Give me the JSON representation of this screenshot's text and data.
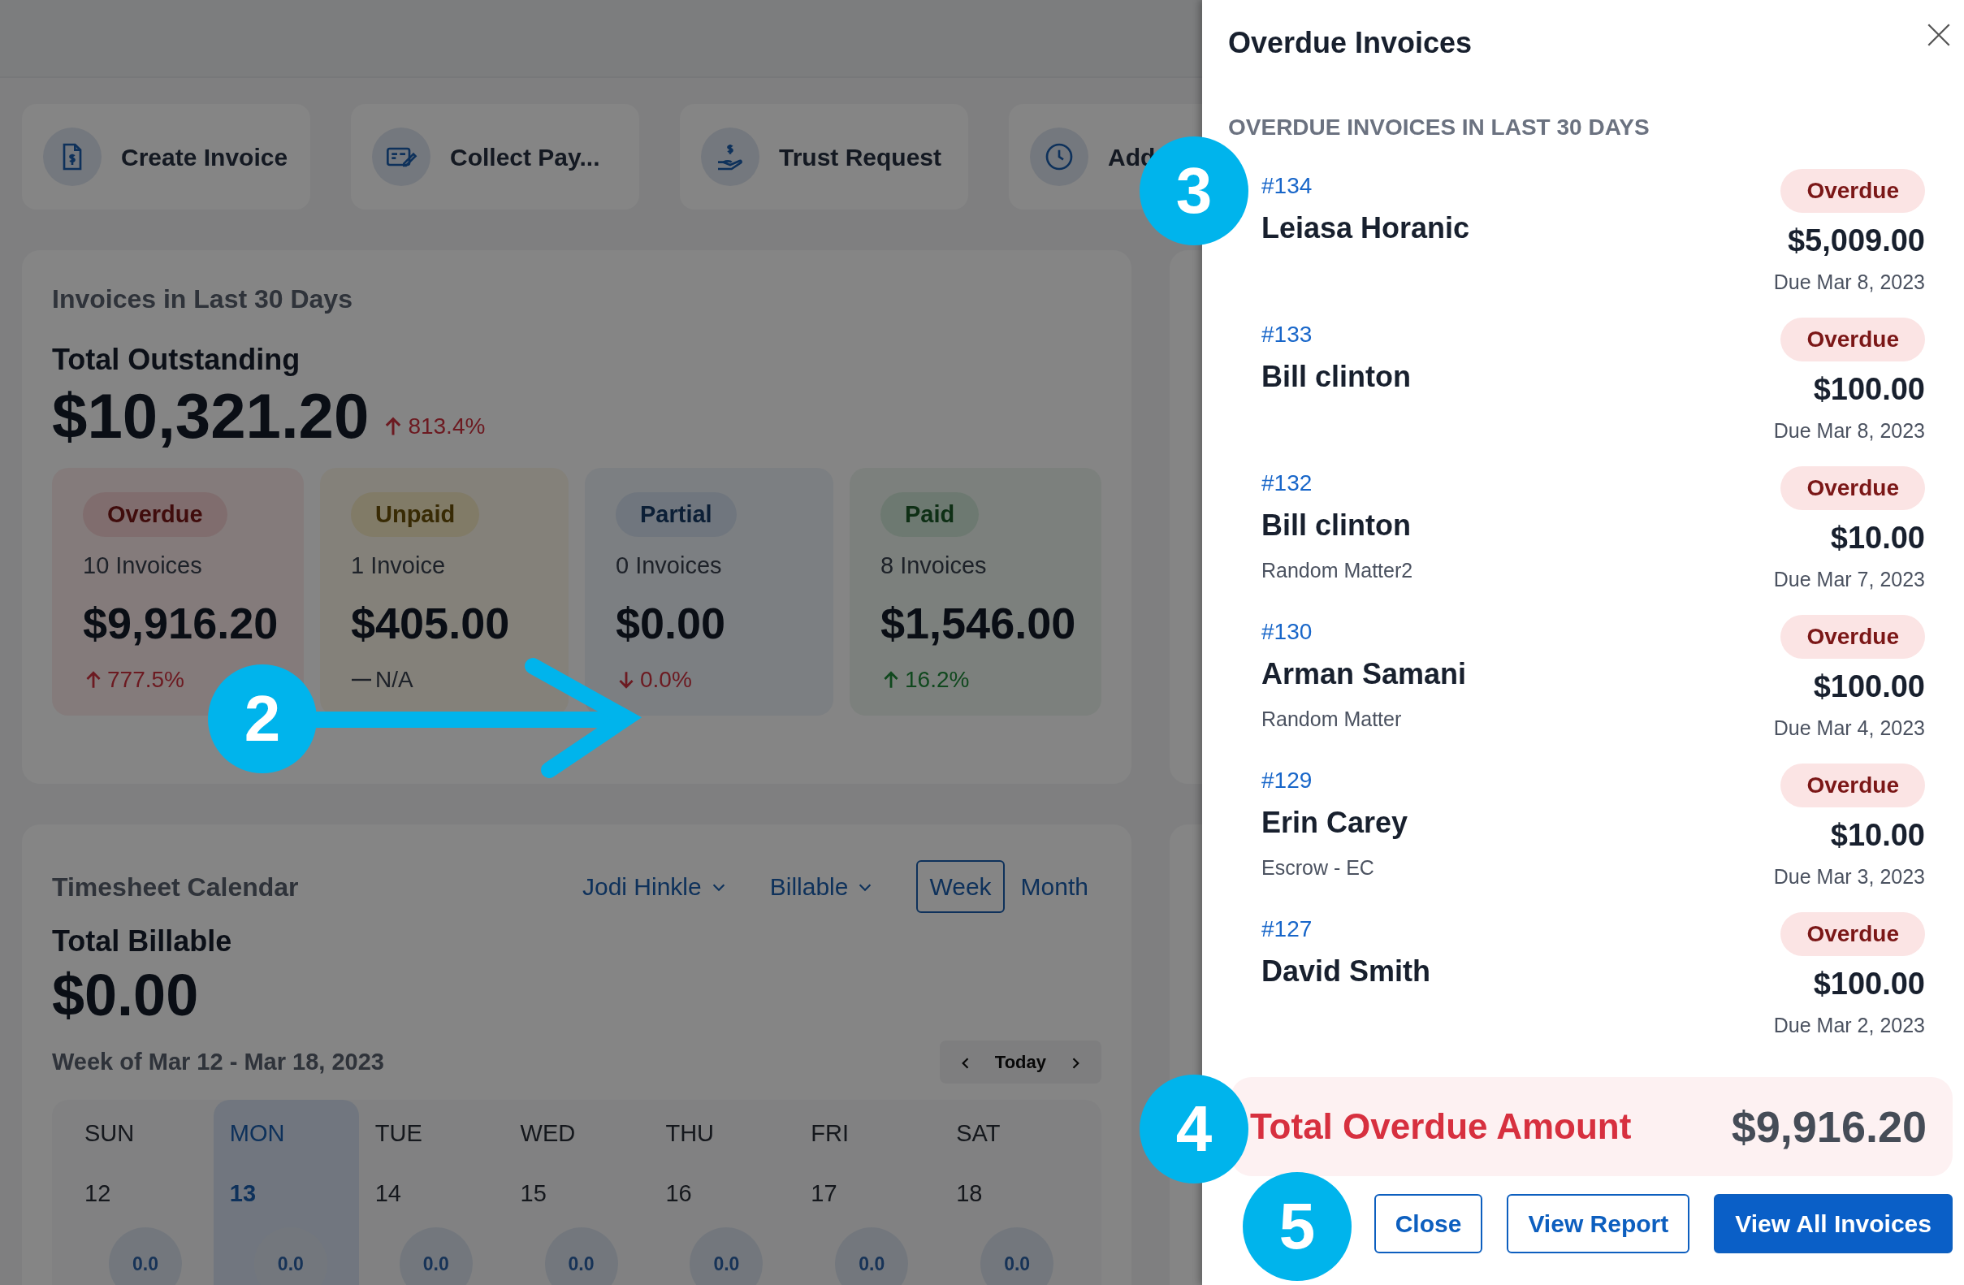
{
  "actions": [
    {
      "kind": "invoice",
      "label": "Create Invoice"
    },
    {
      "kind": "payment",
      "label": "Collect Pay..."
    },
    {
      "kind": "trust",
      "label": "Trust Request"
    },
    {
      "kind": "clock",
      "label": "Add"
    }
  ],
  "invoices_card": {
    "title": "Invoices in Last 30 Days",
    "total_label": "Total Outstanding",
    "total": "$10,321.20",
    "change": {
      "kind": "up",
      "favorable": false,
      "text": "813.4%"
    },
    "stats": [
      {
        "kind": "overdue",
        "badge": "Overdue",
        "count": "10 Invoices",
        "amount": "$9,916.20",
        "change": {
          "kind": "up",
          "favorable": false,
          "text": "777.5%"
        }
      },
      {
        "kind": "unpaid",
        "badge": "Unpaid",
        "count": "1 Invoice",
        "amount": "$405.00",
        "change": {
          "kind": "flat",
          "text": "N/A"
        }
      },
      {
        "kind": "partial",
        "badge": "Partial",
        "count": "0 Invoices",
        "amount": "$0.00",
        "change": {
          "kind": "down",
          "favorable": false,
          "text": "0.0%"
        }
      },
      {
        "kind": "paid",
        "badge": "Paid",
        "count": "8 Invoices",
        "amount": "$1,546.00",
        "change": {
          "kind": "up",
          "favorable": true,
          "text": "16.2%"
        }
      }
    ]
  },
  "timesheet": {
    "title": "Timesheet Calendar",
    "filters": [
      {
        "label": "Jodi Hinkle"
      },
      {
        "label": "Billable"
      }
    ],
    "views": [
      {
        "label": "Week",
        "selected": true
      },
      {
        "label": "Month",
        "selected": false
      }
    ],
    "total_label": "Total Billable",
    "total": "$0.00",
    "week_label": "Week of Mar 12 - Mar 18, 2023",
    "today": "Today",
    "days": [
      {
        "name": "SUN",
        "date": "12",
        "hours": "0.0",
        "selected": false
      },
      {
        "name": "MON",
        "date": "13",
        "hours": "0.0",
        "selected": true
      },
      {
        "name": "TUE",
        "date": "14",
        "hours": "0.0",
        "selected": false
      },
      {
        "name": "WED",
        "date": "15",
        "hours": "0.0",
        "selected": false
      },
      {
        "name": "THU",
        "date": "16",
        "hours": "0.0",
        "selected": false
      },
      {
        "name": "FRI",
        "date": "17",
        "hours": "0.0",
        "selected": false
      },
      {
        "name": "SAT",
        "date": "18",
        "hours": "0.0",
        "selected": false
      }
    ]
  },
  "panel": {
    "title": "Overdue Invoices",
    "subtitle": "OVERDUE INVOICES IN LAST 30 DAYS",
    "items": [
      {
        "number": "#134",
        "client": "Leiasa Horanic",
        "status": "Overdue",
        "amount": "$5,009.00",
        "due": "Due Mar 8, 2023"
      },
      {
        "number": "#133",
        "client": "Bill clinton",
        "status": "Overdue",
        "amount": "$100.00",
        "due": "Due Mar 8, 2023"
      },
      {
        "number": "#132",
        "client": "Bill clinton",
        "matter": "Random Matter2",
        "status": "Overdue",
        "amount": "$10.00",
        "due": "Due Mar 7, 2023"
      },
      {
        "number": "#130",
        "client": "Arman Samani",
        "matter": "Random Matter",
        "status": "Overdue",
        "amount": "$100.00",
        "due": "Due Mar 4, 2023"
      },
      {
        "number": "#129",
        "client": "Erin Carey",
        "matter": "Escrow - EC",
        "status": "Overdue",
        "amount": "$10.00",
        "due": "Due Mar 3, 2023"
      },
      {
        "number": "#127",
        "client": "David Smith",
        "status": "Overdue",
        "amount": "$100.00",
        "due": "Due Mar 2, 2023"
      }
    ],
    "total_label": "Total Overdue Amount",
    "total": "$9,916.20",
    "buttons": [
      {
        "kind": "outline",
        "label": "Close"
      },
      {
        "kind": "outline",
        "label": "View Report"
      },
      {
        "kind": "primary",
        "label": "View All Invoices"
      }
    ]
  },
  "callouts": [
    {
      "number": "2",
      "kind": "arrow"
    },
    {
      "number": "3",
      "kind": "plain"
    },
    {
      "number": "4",
      "kind": "plain"
    },
    {
      "number": "5",
      "kind": "plain"
    }
  ]
}
